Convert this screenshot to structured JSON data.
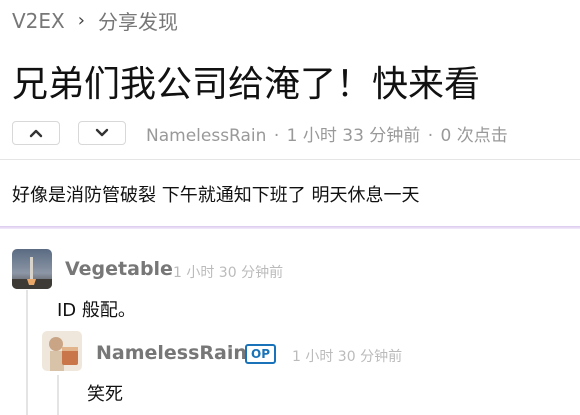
{
  "breadcrumb": {
    "site": "V2EX",
    "separator": "›",
    "node": "分享发现"
  },
  "topic": {
    "title": "兄弟们我公司给淹了！快来看",
    "author": "NamelessRain",
    "time": "1 小时 33 分钟前",
    "clicks": "0 次点击",
    "dot": "·",
    "content": "好像是消防管破裂 下午就通知下班了 明天休息一天"
  },
  "icons": {
    "upvote": "chevron-up-icon",
    "downvote": "chevron-down-icon"
  },
  "replies": [
    {
      "author": "Vegetable",
      "time": "1 小时 30 分钟前",
      "text": "ID 般配。"
    },
    {
      "author": "NamelessRain",
      "badge": "OP",
      "time": "1 小时 30 分钟前",
      "text": "笑死"
    }
  ],
  "colors": {
    "accent": "#1a73b8",
    "divider_purple": "#d9c9ee"
  }
}
